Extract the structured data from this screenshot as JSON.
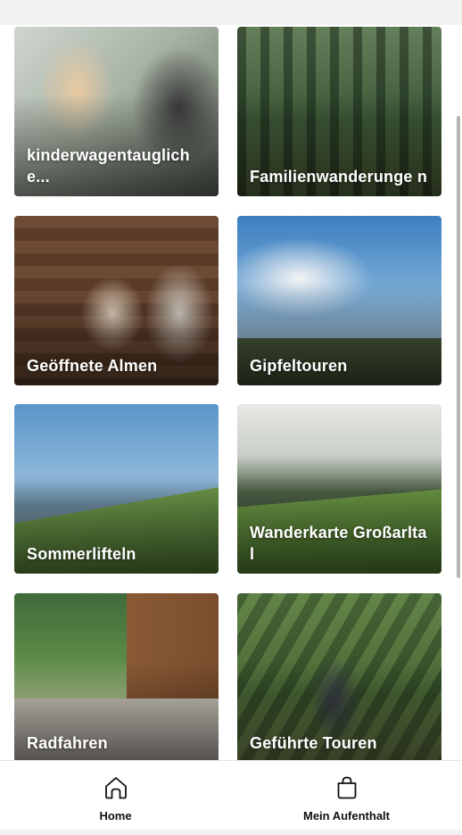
{
  "tiles": [
    {
      "label": "kinderwagentauglich e..."
    },
    {
      "label": "Familienwanderunge n"
    },
    {
      "label": "Geöffnete Almen"
    },
    {
      "label": "Gipfeltouren"
    },
    {
      "label": "Sommerlifteln"
    },
    {
      "label": "Wanderkarte Großarltal"
    },
    {
      "label": "Radfahren"
    },
    {
      "label": "Geführte Touren"
    }
  ],
  "bottom_nav": {
    "home": {
      "label": "Home",
      "icon": "home-icon"
    },
    "stay": {
      "label": "Mein Aufenthalt",
      "icon": "shopping-bag-icon"
    }
  }
}
